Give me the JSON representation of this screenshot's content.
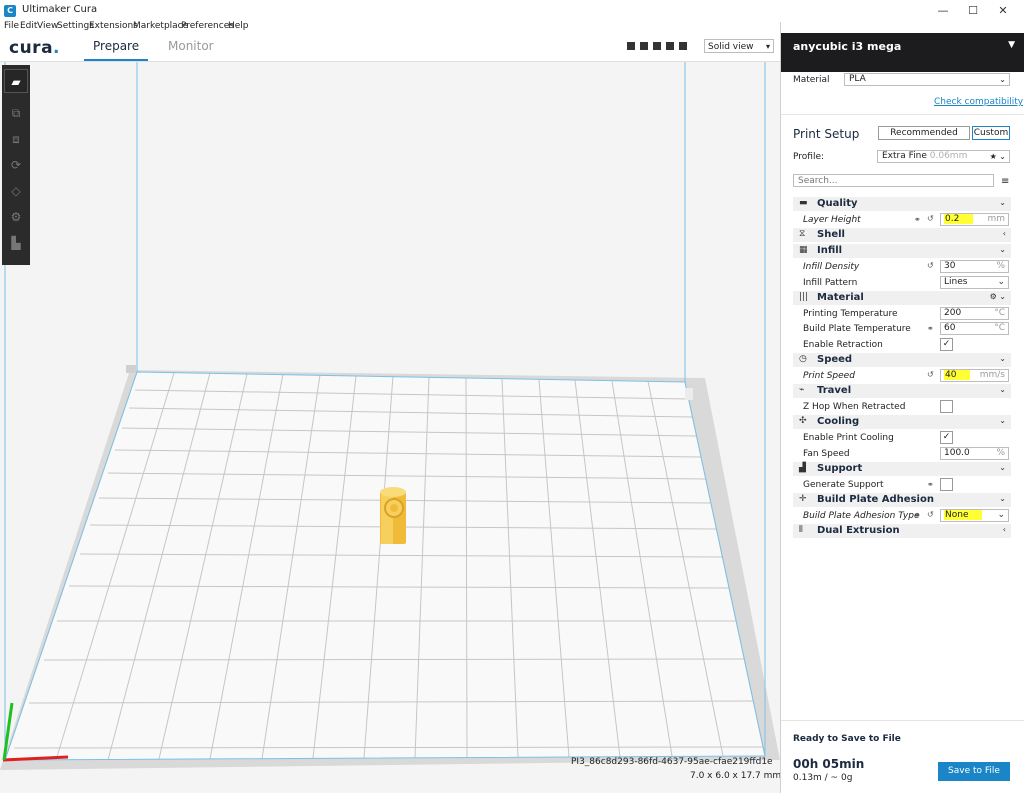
{
  "window": {
    "title": "Ultimaker Cura",
    "icon": "cura-app-icon",
    "controls": [
      "—",
      "☐",
      "✕"
    ]
  },
  "menu": [
    "File",
    "Edit",
    "View",
    "Settings",
    "Extensions",
    "Marketplace",
    "Preferences",
    "Help"
  ],
  "topbar": {
    "logo": "cura",
    "tabs": [
      "Prepare",
      "Monitor"
    ],
    "active_tab": "Prepare",
    "view_mode": "Solid view"
  },
  "toolbar": [
    "open-folder-icon",
    "move-icon",
    "scale-icon",
    "rotate-icon",
    "mirror-icon",
    "per-model-settings-icon",
    "support-blocker-icon"
  ],
  "viewport": {
    "object_name": "PI3_86c8d293-86fd-4637-95ae-cfae219ffd1e",
    "object_dims": "7.0 x 6.0 x 17.7 mm"
  },
  "sidebar": {
    "printer": "anycubic i3 mega",
    "material_label": "Material",
    "material_value": "PLA",
    "check_compat": "Check compatibility",
    "print_setup": "Print Setup",
    "mode_recommended": "Recommended",
    "mode_custom": "Custom",
    "profile_label": "Profile:",
    "profile_value": "Extra Fine",
    "profile_hint": "0.06mm",
    "search_placeholder": "Search...",
    "categories": {
      "quality": "Quality",
      "shell": "Shell",
      "infill": "Infill",
      "material": "Material",
      "speed": "Speed",
      "travel": "Travel",
      "cooling": "Cooling",
      "support": "Support",
      "adhesion": "Build Plate Adhesion",
      "dual": "Dual Extrusion"
    },
    "settings": {
      "layer_height": {
        "label": "Layer Height",
        "value": "0.2",
        "unit": "mm"
      },
      "infill_density": {
        "label": "Infill Density",
        "value": "30",
        "unit": "%"
      },
      "infill_pattern": {
        "label": "Infill Pattern",
        "value": "Lines"
      },
      "print_temp": {
        "label": "Printing Temperature",
        "value": "200",
        "unit": "°C"
      },
      "bed_temp": {
        "label": "Build Plate Temperature",
        "value": "60",
        "unit": "°C"
      },
      "retraction": {
        "label": "Enable Retraction",
        "checked": true
      },
      "print_speed": {
        "label": "Print Speed",
        "value": "40",
        "unit": "mm/s"
      },
      "zhop": {
        "label": "Z Hop When Retracted",
        "checked": false
      },
      "print_cooling": {
        "label": "Enable Print Cooling",
        "checked": true
      },
      "fan_speed": {
        "label": "Fan Speed",
        "value": "100.0",
        "unit": "%"
      },
      "gen_support": {
        "label": "Generate Support",
        "checked": false
      },
      "adhesion_type": {
        "label": "Build Plate Adhesion Type",
        "value": "None"
      }
    },
    "footer": {
      "status": "Ready to Save to File",
      "time": "00h 05min",
      "usage": "0.13m / ~ 0g",
      "save": "Save to File"
    }
  },
  "colors": {
    "accent": "#1a86c7",
    "highlight": "#ffff33",
    "model": "#f5c242",
    "dark": "#1c1c1e"
  }
}
